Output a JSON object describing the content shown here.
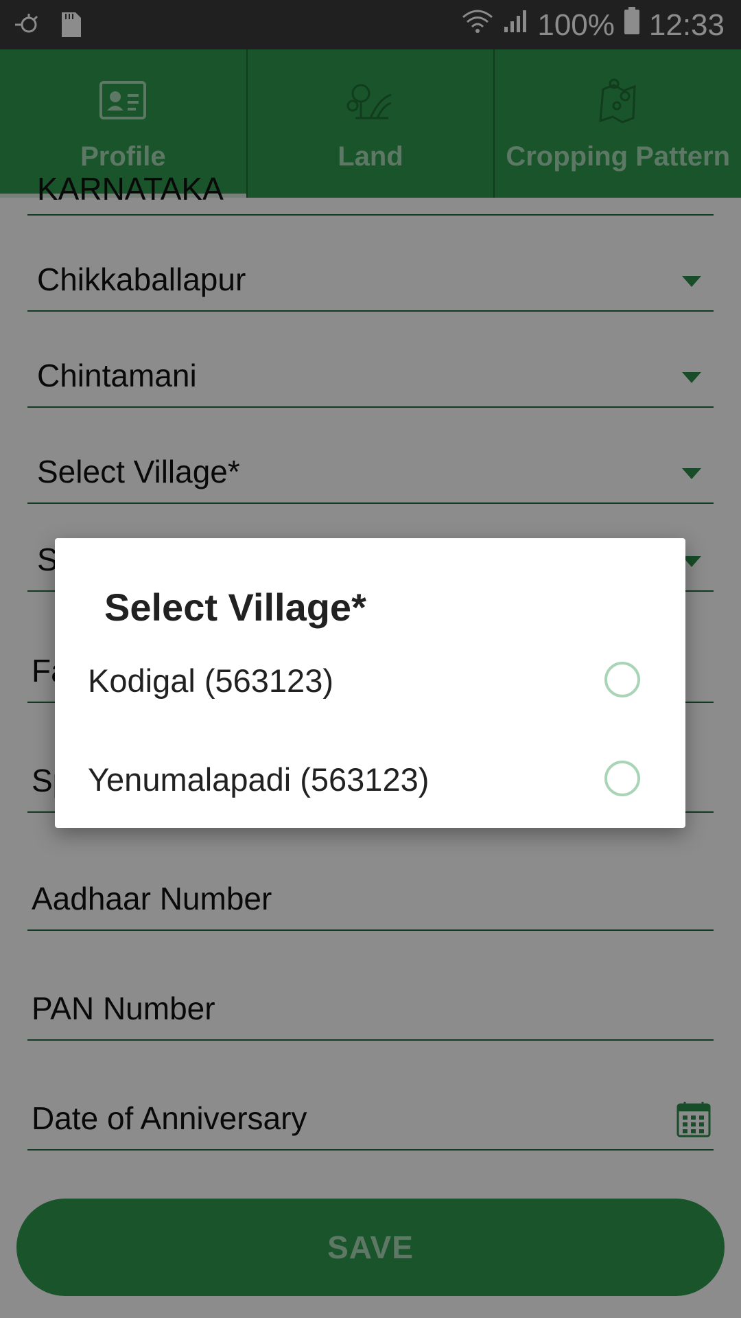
{
  "status_bar": {
    "battery_percent": "100%",
    "time": "12:33"
  },
  "tabs": [
    {
      "label": "Profile",
      "icon": "profile-card-icon",
      "active": true
    },
    {
      "label": "Land",
      "icon": "land-icon",
      "active": false
    },
    {
      "label": "Cropping Pattern",
      "icon": "map-pins-icon",
      "active": false
    }
  ],
  "form": {
    "state_value": "KARNATAKA",
    "district_value": "Chikkaballapur",
    "taluk_value": "Chintamani",
    "village_value": "Select Village*",
    "next_partial": "S",
    "father_partial": "Fa",
    "spouse_partial": "Sp",
    "aadhaar_placeholder": "Aadhaar Number",
    "pan_placeholder": "PAN Number",
    "anniversary_placeholder": "Date of Anniversary"
  },
  "save_label": "SAVE",
  "dialog": {
    "title": "Select Village*",
    "options": [
      {
        "label": "Kodigal (563123)",
        "selected": false
      },
      {
        "label": "Yenumalapadi (563123)",
        "selected": false
      }
    ]
  },
  "colors": {
    "primary": "#2e9a4e",
    "status_bar": "#3b3b3b",
    "radio": "#a9d4b5"
  }
}
